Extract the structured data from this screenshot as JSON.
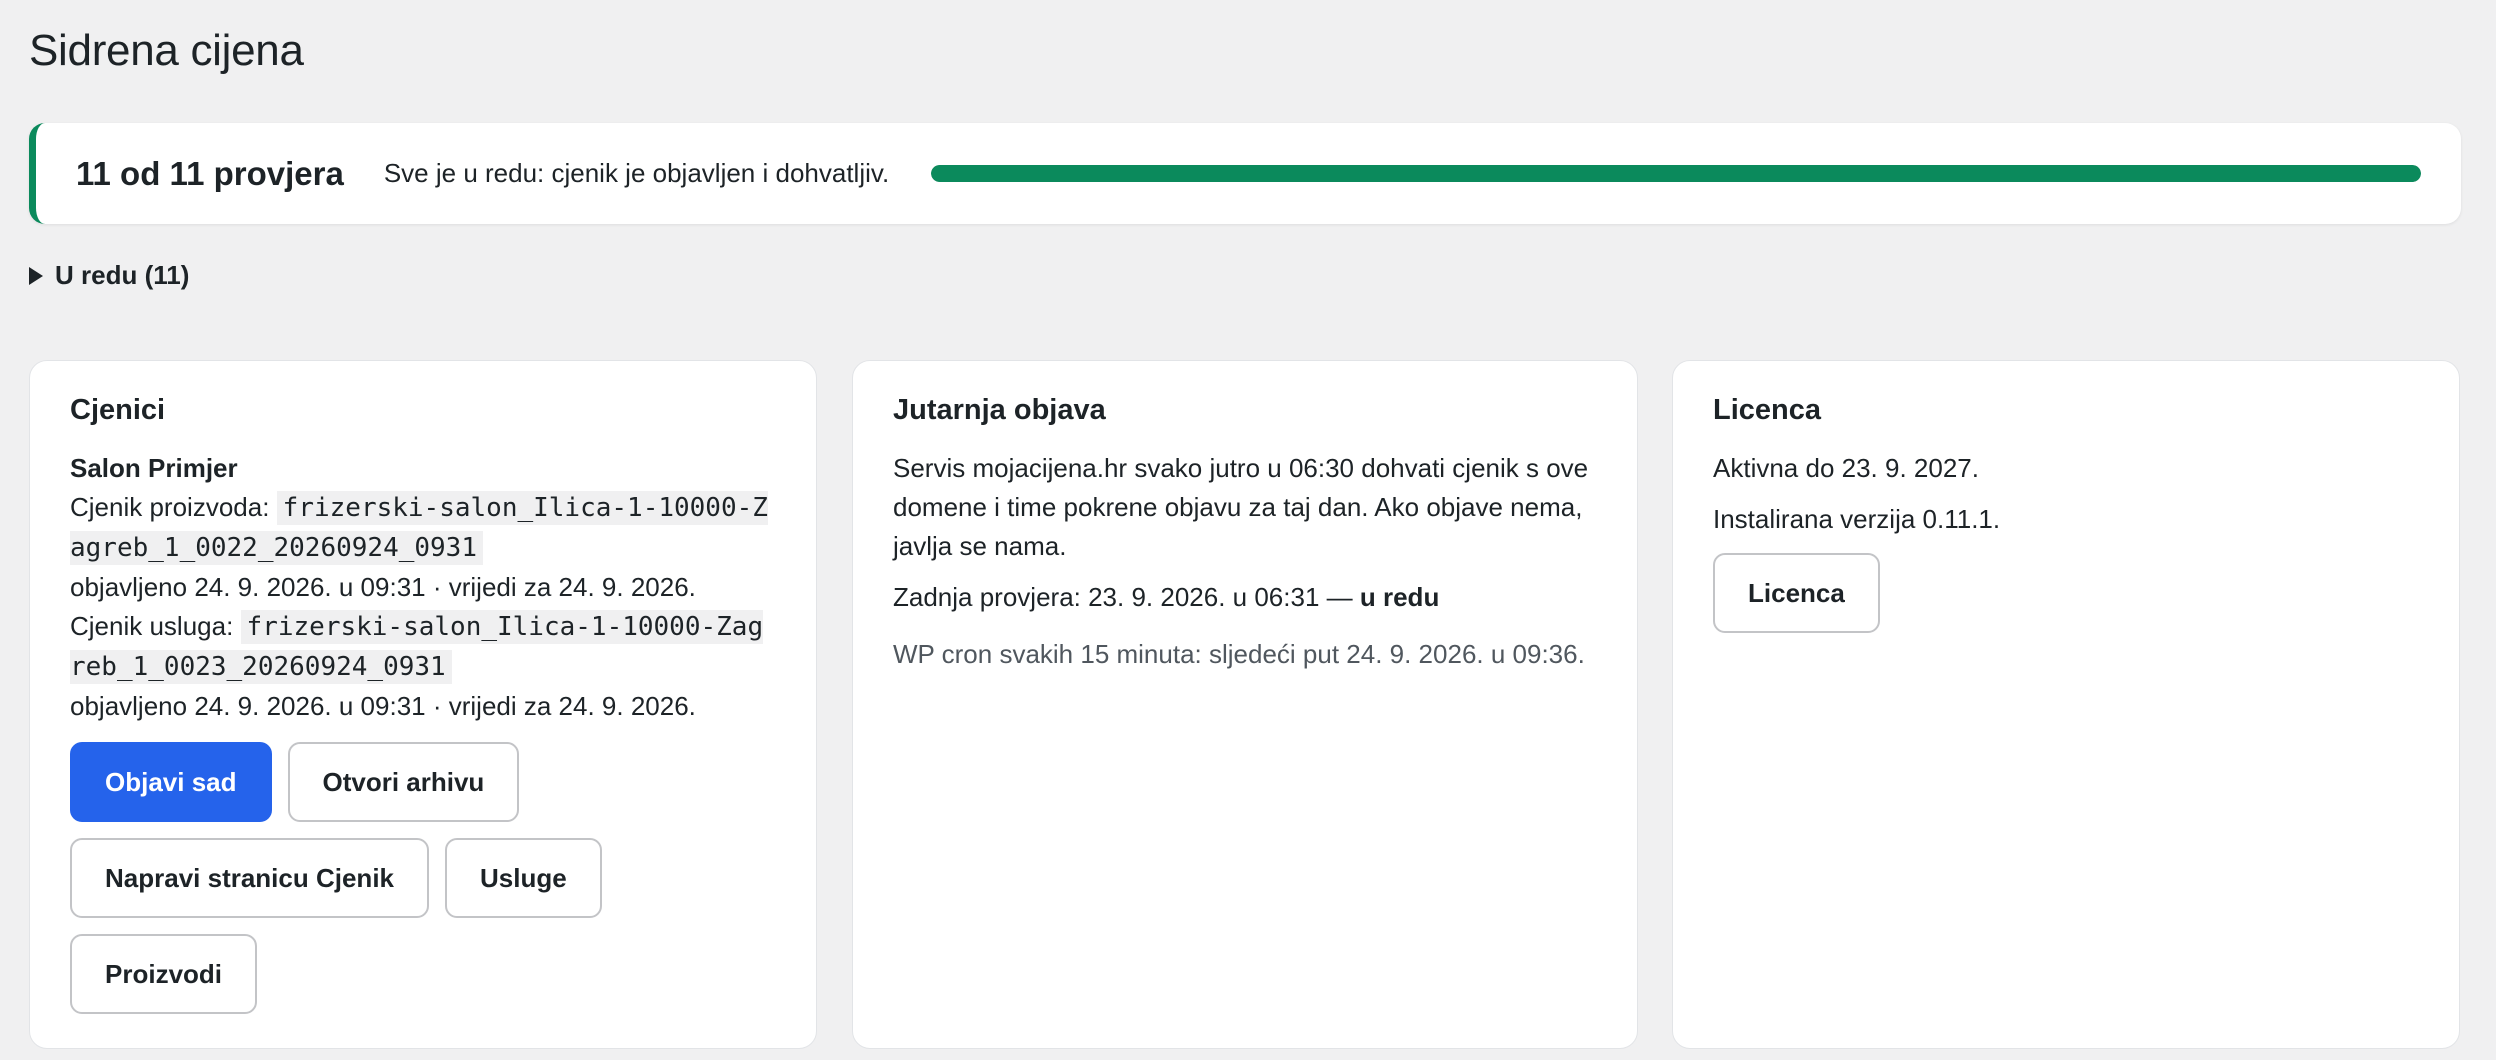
{
  "page": {
    "title": "Sidrena cijena"
  },
  "summary": {
    "count": "11 od 11 provjera",
    "message": "Sve je u redu: cjenik je objavljen i dohvatljiv.",
    "progress": 1.0,
    "progress_color": "#0b8a5c",
    "accent_color": "#0b8a5c"
  },
  "details": {
    "label": "U redu (11)"
  },
  "cjenici": {
    "title": "Cjenici",
    "salon_name": "Salon Primjer",
    "products_label": "Cjenik proizvoda:",
    "products_file": "frizerski-salon_Ilica-1-10000-Zagreb_1_0022_20260924_0931",
    "products_published": "objavljeno 24. 9. 2026. u 09:31 · vrijedi za 24. 9. 2026.",
    "services_label": "Cjenik usluga:",
    "services_file": "frizerski-salon_Ilica-1-10000-Zagreb_1_0023_20260924_0931",
    "services_published": "objavljeno 24. 9. 2026. u 09:31 · vrijedi za 24. 9. 2026.",
    "buttons": {
      "publish_now": "Objavi sad",
      "open_archive": "Otvori arhivu",
      "make_page": "Napravi stranicu Cjenik",
      "services": "Usluge",
      "products": "Proizvodi"
    },
    "primary_color": "#2563eb"
  },
  "jutarnja": {
    "title": "Jutarnja objava",
    "description": "Servis mojacijena.hr svako jutro u 06:30 dohvati cjenik s ove domene i time pokrene objavu za taj dan. Ako objave nema, javlja se nama.",
    "last_check_label": "Zadnja provjera: 23. 9. 2026. u 06:31 —",
    "last_check_status": "u redu",
    "cron_text": "WP cron svakih 15 minuta: sljedeći put 24. 9. 2026. u 09:36."
  },
  "licenca": {
    "title": "Licenca",
    "active_until": "Aktivna do 23. 9. 2027.",
    "installed_version": "Instalirana verzija 0.11.1.",
    "button": "Licenca"
  }
}
